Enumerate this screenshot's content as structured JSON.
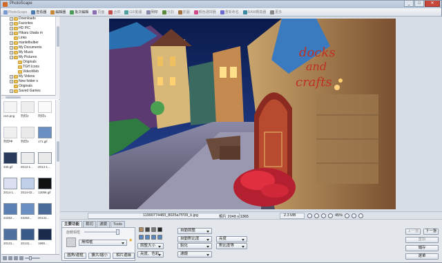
{
  "app": {
    "title": "PhotoScape"
  },
  "window_controls": {
    "minimize": "_",
    "maximize": "□",
    "close": "✕"
  },
  "toolbar": {
    "items": [
      {
        "label": "PhotoScape",
        "icon": "photoscape-icon",
        "disabled": true
      },
      {
        "label": "查看器",
        "icon": "viewer-icon"
      },
      {
        "label": "編輯器",
        "icon": "editor-icon"
      },
      {
        "label": "批次編輯",
        "icon": "batch-editor-icon"
      },
      {
        "label": "頁面",
        "icon": "page-icon",
        "disabled": true
      },
      {
        "label": "合併",
        "icon": "combine-icon",
        "disabled": true
      },
      {
        "label": "GIF動畫",
        "icon": "gif-icon",
        "disabled": true
      },
      {
        "label": "列印",
        "icon": "print-icon"
      },
      {
        "label": "分割",
        "icon": "splitter-icon",
        "disabled": true
      },
      {
        "label": "抓圖",
        "icon": "screen-capture-icon",
        "disabled": true
      },
      {
        "label": "顏色選擇器",
        "icon": "color-picker-icon",
        "disabled": true
      },
      {
        "label": "重新命名",
        "icon": "rename-icon",
        "disabled": true
      },
      {
        "label": "RAW轉換器",
        "icon": "raw-converter-icon",
        "disabled": true
      },
      {
        "label": "更多",
        "icon": "more-icon",
        "disabled": true
      }
    ]
  },
  "folder_tree": {
    "nodes": [
      {
        "label": "Downloads",
        "indent": 2,
        "expander": "+"
      },
      {
        "label": "Favorites",
        "indent": 2,
        "expander": "+"
      },
      {
        "label": "HD PIC",
        "indent": 2,
        "expander": "+"
      },
      {
        "label": "Hikaru Utada m",
        "indent": 2,
        "expander": "+"
      },
      {
        "label": "Links",
        "indent": 2,
        "expander": ""
      },
      {
        "label": "mantelbulber",
        "indent": 2,
        "expander": "+"
      },
      {
        "label": "My Documents",
        "indent": 2,
        "expander": "+"
      },
      {
        "label": "My Music",
        "indent": 2,
        "expander": "+"
      },
      {
        "label": "My Pictures",
        "indent": 2,
        "expander": "−"
      },
      {
        "label": "Originals",
        "indent": 3,
        "expander": ""
      },
      {
        "label": "TGH Icons",
        "indent": 3,
        "expander": ""
      },
      {
        "label": "VideoWeb",
        "indent": 3,
        "expander": ""
      },
      {
        "label": "My Videos",
        "indent": 2,
        "expander": "+"
      },
      {
        "label": "New folder o",
        "indent": 2,
        "expander": "+"
      },
      {
        "label": "Originals",
        "indent": 2,
        "expander": ""
      },
      {
        "label": "Saved Games",
        "indent": 2,
        "expander": "+"
      }
    ]
  },
  "thumbnails": {
    "labels": [
      "rect.png",
      "列印2",
      "列印1",
      "列印中",
      "列印3",
      "171.gif",
      "345.gif",
      "2013-1...",
      "2013-1...",
      "2014-1...",
      "2014-02...",
      "13098.gif",
      "22252...",
      "22252...",
      "20131...",
      "20131...",
      "20131...",
      "1990..."
    ]
  },
  "viewer": {
    "filename": "11990774483_8025a7f709_k.jpg",
    "resolution": "相片 2048 x 1365",
    "filesize": "2.3 MB",
    "zoom": "45%"
  },
  "bottom_panel": {
    "tabs": [
      "主要功能",
      "裁切",
      "濾鏡",
      "Tools"
    ],
    "active_tab": 0,
    "slider_label": "旋轉相框",
    "frame_dropdown": "無相框",
    "tab_buttons": [
      "圓角/邊框",
      "擴大/縮小",
      "相片邊緣"
    ],
    "mid_dropdowns": [
      "自動調整",
      "自動對比度",
      "調整大小",
      "銳化",
      "亮度、色彩",
      "濾鏡"
    ],
    "right_dropdowns": [
      "亮度",
      "對比度等"
    ],
    "side_buttons": {
      "prev": "上一張",
      "next": "下一張",
      "reset": "重設",
      "save": "儲存",
      "menu": "選單"
    }
  }
}
